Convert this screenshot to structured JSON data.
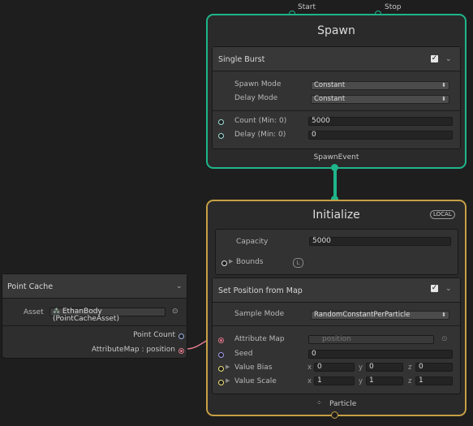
{
  "colors": {
    "spawn_accent": "#1fb58a",
    "initialize_accent": "#c7a044",
    "attribute_map_port": "#e07b8e",
    "count_port": "#9fe0dc",
    "seed_port": "#a59cf0",
    "vector_port": "#f0e27a"
  },
  "spawn": {
    "start_label": "Start",
    "stop_label": "Stop",
    "title": "Spawn",
    "event_label": "SpawnEvent",
    "block": {
      "title": "Single Burst",
      "spawn_mode_label": "Spawn Mode",
      "spawn_mode_value": "Constant",
      "delay_mode_label": "Delay Mode",
      "delay_mode_value": "Constant",
      "count_label": "Count (Min: 0)",
      "count_value": "5000",
      "delay_label": "Delay (Min: 0)",
      "delay_value": "0"
    }
  },
  "initialize": {
    "title": "Initialize",
    "space_badge": "LOCAL",
    "capacity_label": "Capacity",
    "capacity_value": "5000",
    "bounds_label": "Bounds",
    "bounds_badge": "L",
    "particle_label": "Particle",
    "block": {
      "title": "Set Position from Map",
      "sample_mode_label": "Sample Mode",
      "sample_mode_value": "RandomConstantPerParticle",
      "attribute_map_label": "Attribute Map",
      "attribute_map_value": "position",
      "seed_label": "Seed",
      "seed_value": "0",
      "value_bias_label": "Value Bias",
      "value_bias": {
        "x": "0",
        "y": "0",
        "z": "0"
      },
      "value_scale_label": "Value Scale",
      "value_scale": {
        "x": "1",
        "y": "1",
        "z": "1"
      },
      "axis_x": "x",
      "axis_y": "y",
      "axis_z": "z"
    }
  },
  "point_cache": {
    "title": "Point Cache",
    "asset_label": "Asset",
    "asset_value": "EthanBody (PointCacheAsset)",
    "point_count_label": "Point Count",
    "attribute_map_label": "AttributeMap : position"
  }
}
